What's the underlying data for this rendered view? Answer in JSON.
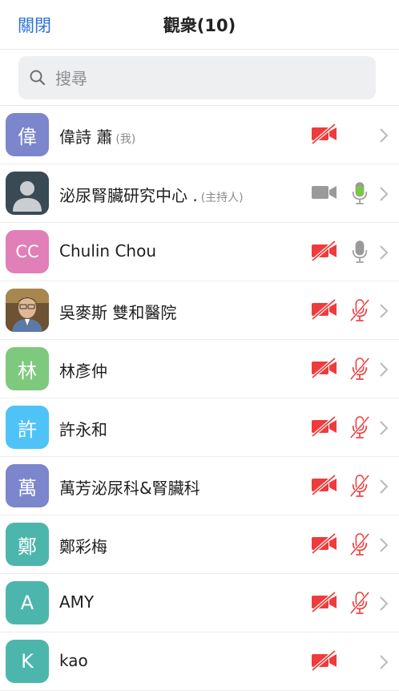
{
  "header": {
    "close_label": "關閉",
    "title": "觀衆(10)"
  },
  "search": {
    "placeholder": "搜尋"
  },
  "participants": [
    {
      "name": "偉詩 蕭",
      "tag": "(我)",
      "initial": "偉",
      "avatar_color": "#7b86cc",
      "video": "off",
      "mic": "none"
    },
    {
      "name": "泌尿腎臟研究中心 .",
      "tag": "(主持人)",
      "initial": "",
      "avatar_color": "#3a4a55",
      "avatar_icon": "person-silhouette-icon",
      "video": "on",
      "mic": "active"
    },
    {
      "name": "Chulin Chou",
      "tag": "",
      "initial": "CC",
      "avatar_color": "#e07fb8",
      "video": "off",
      "mic": "on"
    },
    {
      "name": "吳麥斯 雙和醫院",
      "tag": "",
      "initial": "",
      "avatar_color": "#7a5a3a",
      "avatar_icon": "profile-photo",
      "video": "off",
      "mic": "muted"
    },
    {
      "name": "林彥仲",
      "tag": "",
      "initial": "林",
      "avatar_color": "#7fc97f",
      "video": "off",
      "mic": "muted"
    },
    {
      "name": "許永和",
      "tag": "",
      "initial": "許",
      "avatar_color": "#4fc3f7",
      "video": "off",
      "mic": "muted"
    },
    {
      "name": "萬芳泌尿科&腎臟科",
      "tag": "",
      "initial": "萬",
      "avatar_color": "#7b86cc",
      "video": "off",
      "mic": "muted"
    },
    {
      "name": "鄭彩梅",
      "tag": "",
      "initial": "鄭",
      "avatar_color": "#4db6ac",
      "video": "off",
      "mic": "muted"
    },
    {
      "name": "AMY",
      "tag": "",
      "initial": "A",
      "avatar_color": "#4db6ac",
      "video": "off",
      "mic": "muted"
    },
    {
      "name": "kao",
      "tag": "",
      "initial": "K",
      "avatar_color": "#4db6ac",
      "video": "off",
      "mic": "none"
    }
  ],
  "colors": {
    "accent": "#2d73d6",
    "muted_red": "#ef3b3b",
    "mic_active_green": "#7ac943",
    "icon_gray": "#9a9a9a"
  }
}
